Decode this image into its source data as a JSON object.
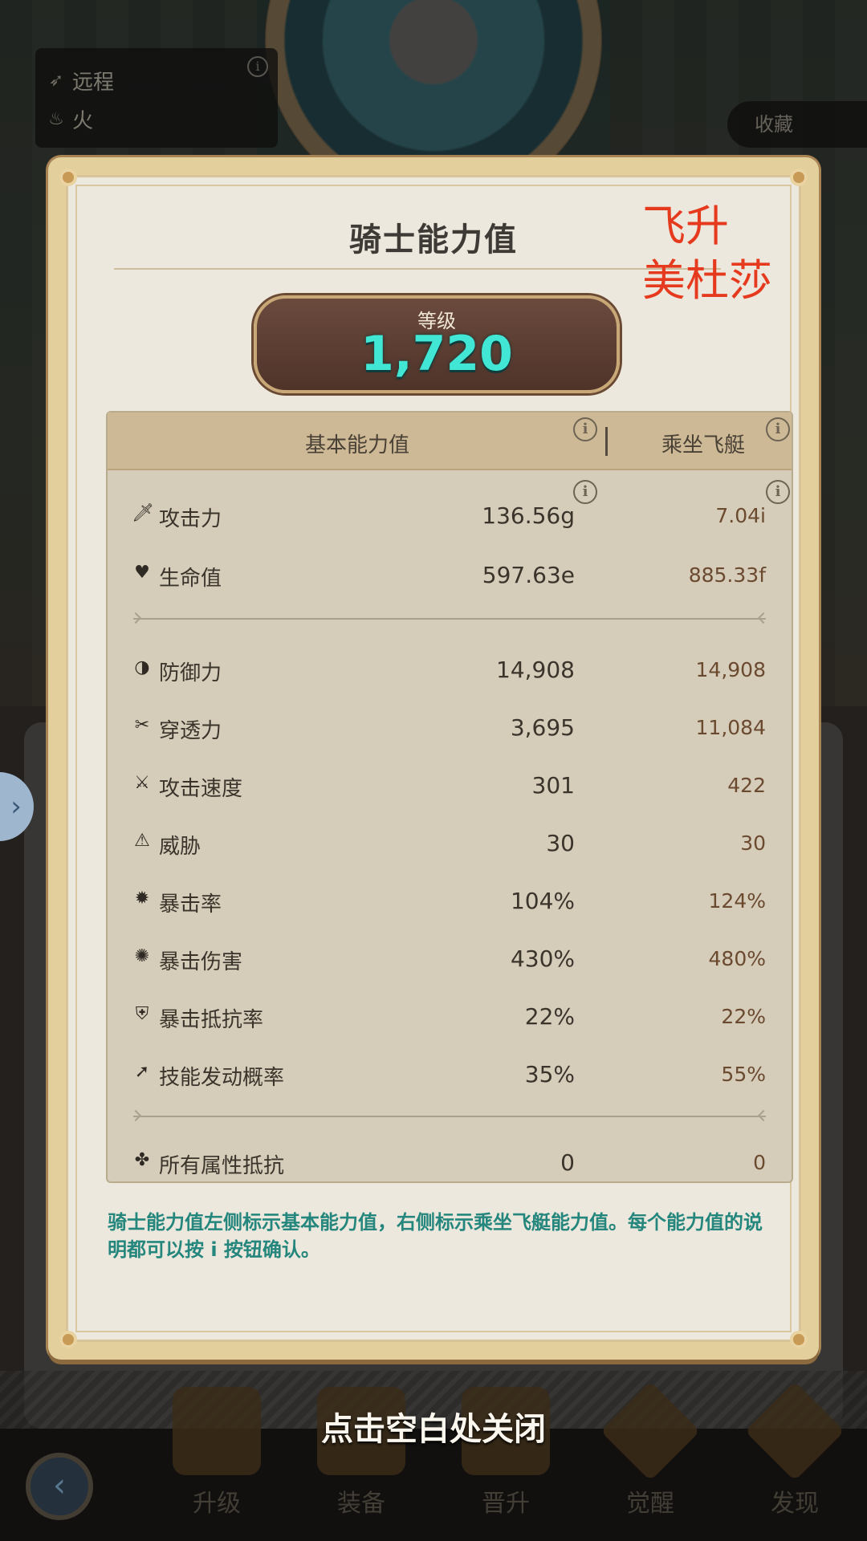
{
  "attributes": {
    "range": "远程",
    "element": "火"
  },
  "top_right": {
    "collect": "收藏"
  },
  "modal": {
    "title": "骑士能力值",
    "annotation_line1": "飞升",
    "annotation_line2": "美杜莎",
    "level_label": "等级",
    "level_value": "1,720",
    "columns": {
      "base": "基本能力值",
      "ship": "乘坐飞艇"
    },
    "stats_primary": [
      {
        "icon": "sword-icon",
        "glyph": "🗡",
        "name": "攻击力",
        "base": "136.56g",
        "ship": "7.04i"
      },
      {
        "icon": "heart-icon",
        "glyph": "♥",
        "name": "生命值",
        "base": "597.63e",
        "ship": "885.33f"
      }
    ],
    "stats_secondary": [
      {
        "icon": "shield-icon",
        "glyph": "◑",
        "name": "防御力",
        "base": "14,908",
        "ship": "14,908"
      },
      {
        "icon": "penetration-icon",
        "glyph": "✂",
        "name": "穿透力",
        "base": "3,695",
        "ship": "11,084"
      },
      {
        "icon": "attack-speed-icon",
        "glyph": "⚔",
        "name": "攻击速度",
        "base": "301",
        "ship": "422"
      },
      {
        "icon": "threat-icon",
        "glyph": "⚠",
        "name": "威胁",
        "base": "30",
        "ship": "30"
      },
      {
        "icon": "crit-rate-icon",
        "glyph": "✹",
        "name": "暴击率",
        "base": "104%",
        "ship": "124%"
      },
      {
        "icon": "crit-damage-icon",
        "glyph": "✺",
        "name": "暴击伤害",
        "base": "430%",
        "ship": "480%"
      },
      {
        "icon": "crit-resist-icon",
        "glyph": "⛨",
        "name": "暴击抵抗率",
        "base": "22%",
        "ship": "22%"
      },
      {
        "icon": "skill-trigger-icon",
        "glyph": "➚",
        "name": "技能发动概率",
        "base": "35%",
        "ship": "55%"
      }
    ],
    "stats_tertiary": [
      {
        "icon": "all-resist-icon",
        "glyph": "✤",
        "name": "所有属性抵抗",
        "base": "0",
        "ship": "0"
      }
    ],
    "help_text": "骑士能力值左侧标示基本能力值，右侧标示乘坐飞艇能力值。每个能力值的说明都可以按 i 按钮确认。"
  },
  "close_hint": "点击空白处关闭",
  "bottom_nav": [
    "升级",
    "装备",
    "晋升",
    "觉醒",
    "发现"
  ],
  "colors": {
    "level_value": "#41e6d4",
    "help_text": "#24867c",
    "annotation": "#e63a1f"
  }
}
